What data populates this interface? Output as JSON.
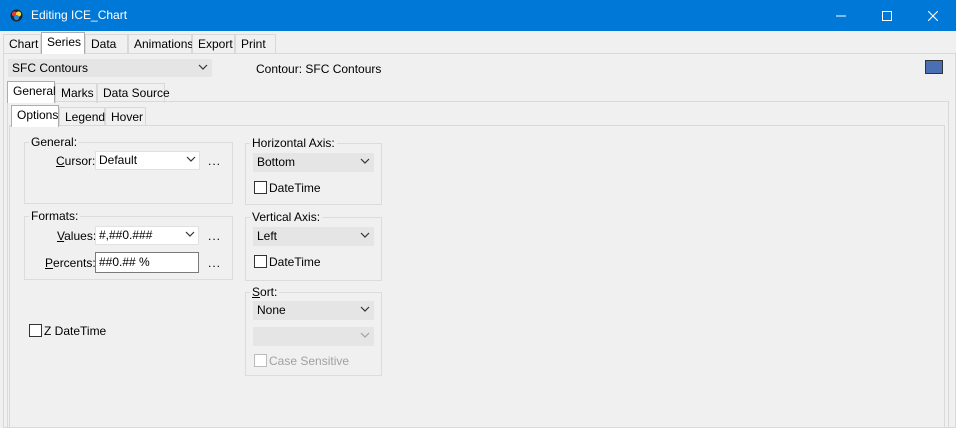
{
  "window": {
    "title": "Editing ICE_Chart",
    "controls": {
      "minimize": "–",
      "maximize": "☐",
      "close": "✕"
    }
  },
  "top_tabs": [
    {
      "label": "Chart"
    },
    {
      "label": "Series"
    },
    {
      "label": "Data"
    },
    {
      "label": "Animations"
    },
    {
      "label": "Export"
    },
    {
      "label": "Print"
    }
  ],
  "series_selector": {
    "value": "SFC Contours"
  },
  "contour_label": "Contour: SFC Contours",
  "series_color": "#4a6fb5",
  "series_tabs": [
    {
      "label": "General"
    },
    {
      "label": "Marks"
    },
    {
      "label": "Data Source"
    }
  ],
  "general_tabs": [
    {
      "label": "Options"
    },
    {
      "label": "Legend"
    },
    {
      "label": "Hover"
    }
  ],
  "general_group": {
    "title": "General:",
    "cursor_label_pre": "",
    "cursor_label_u": "C",
    "cursor_label_post": "ursor:",
    "cursor_value": "Default"
  },
  "formats_group": {
    "title": "Formats:",
    "values_label_u": "V",
    "values_label_post": "alues:",
    "values_value": "#,##0.###",
    "percents_label_u": "P",
    "percents_label_post": "ercents:",
    "percents_value": "##0.## %"
  },
  "ellipsis": "...",
  "z_datetime": {
    "label": "Z DateTime",
    "checked": false
  },
  "horizontal_axis": {
    "title": "Horizontal Axis:",
    "value": "Bottom",
    "datetime_label": "DateTime"
  },
  "vertical_axis": {
    "title": "Vertical Axis:",
    "value": "Left",
    "datetime_label": "DateTime"
  },
  "sort": {
    "title_u": "S",
    "title_post": "ort:",
    "value": "None",
    "secondary_value": "",
    "case_sensitive_label": "Case Sensitive"
  }
}
